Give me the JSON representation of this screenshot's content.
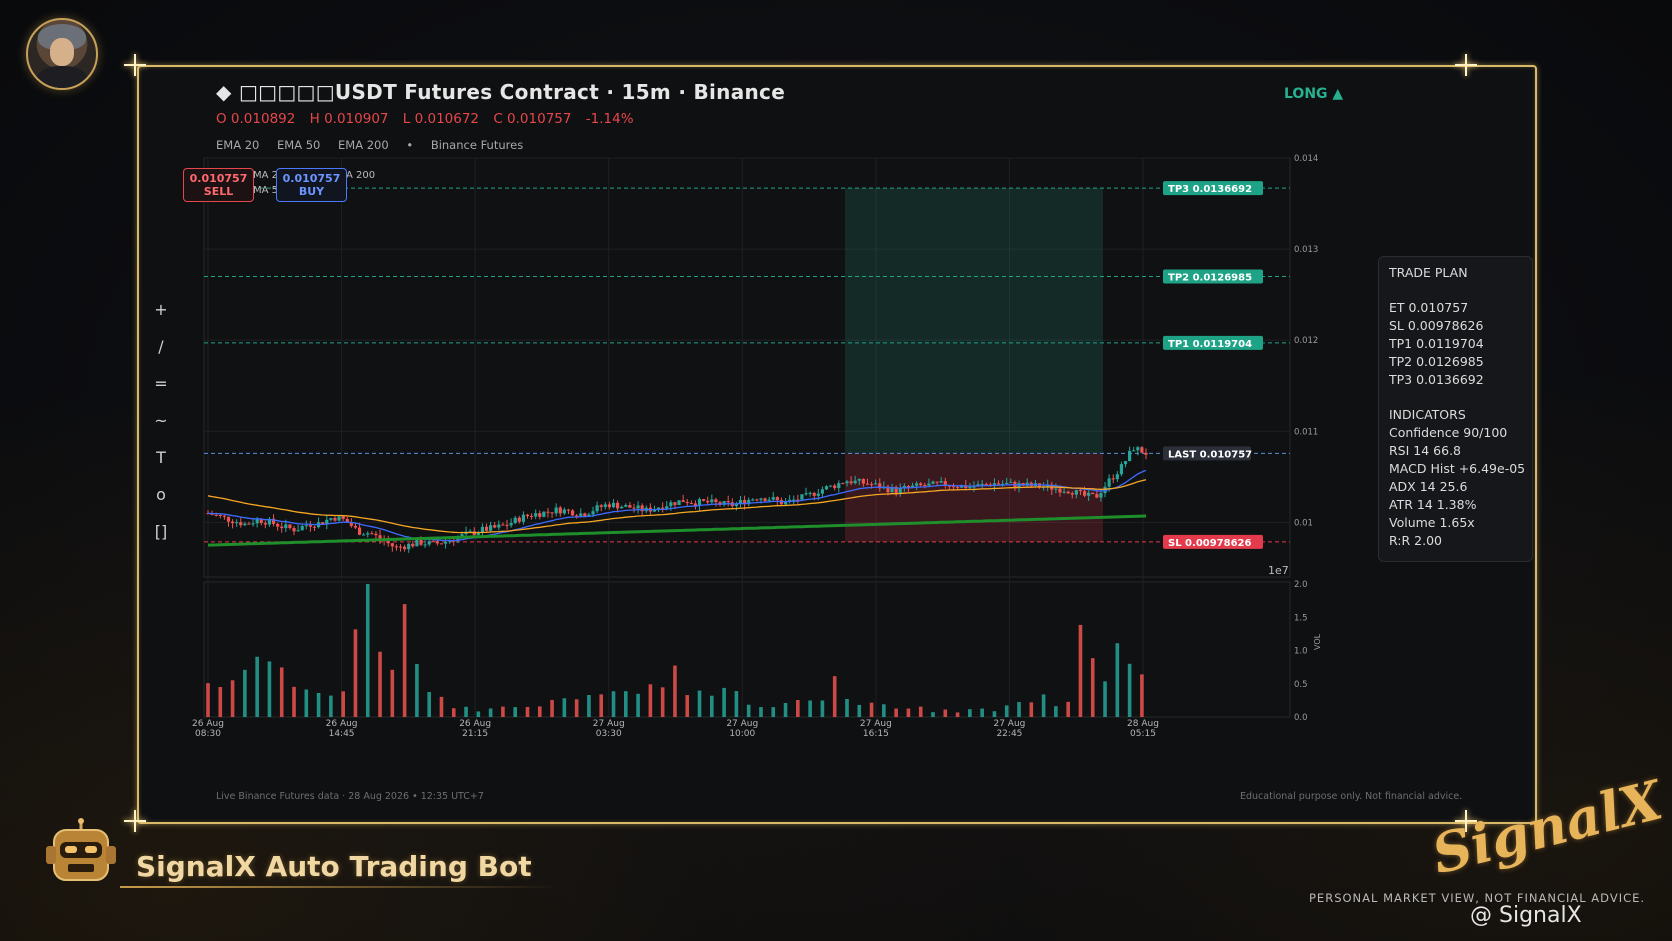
{
  "header": {
    "symbol_icon": "diamond",
    "title": "◆  □□□□□USDT Futures Contract  ·  15m  ·  Binance",
    "ohlc": {
      "o": "O 0.010892",
      "h": "H 0.010907",
      "l": "L 0.010672",
      "c": "C 0.010757",
      "chg": "-1.14%"
    },
    "indicators": [
      "EMA 20",
      "EMA 50",
      "EMA 200",
      "•",
      "Binance Futures"
    ],
    "direction": "LONG ▲"
  },
  "toolbar": [
    "+",
    "/",
    "=",
    "~",
    "T",
    "o",
    "[]"
  ],
  "order_buttons": {
    "sell_price": "0.010757",
    "sell_label": "SELL",
    "buy_price": "0.010757",
    "buy_label": "BUY",
    "ma_fragments": [
      "MA 2",
      "MA 5",
      "A 200"
    ]
  },
  "levels": {
    "tp3": "TP3  0.0136692",
    "tp2": "TP2  0.0126985",
    "tp1": "TP1  0.0119704",
    "last": "LAST  0.010757",
    "sl": "SL  0.00978626"
  },
  "price_axis": [
    "0.014",
    "0.013",
    "0.012",
    "0.011",
    "0.01"
  ],
  "price_multiplier": "1e7",
  "volume_axis": [
    "2.0",
    "1.5",
    "1.0",
    "0.5",
    "0.0"
  ],
  "volume_label": "VOL",
  "time_axis": [
    [
      "26 Aug",
      "08:30"
    ],
    [
      "26 Aug",
      "14:45"
    ],
    [
      "26 Aug",
      "21:15"
    ],
    [
      "27 Aug",
      "03:30"
    ],
    [
      "27 Aug",
      "10:00"
    ],
    [
      "27 Aug",
      "16:15"
    ],
    [
      "27 Aug",
      "22:45"
    ],
    [
      "28 Aug",
      "05:15"
    ]
  ],
  "trade_plan": {
    "title": "TRADE PLAN",
    "et": "ET     0.010757",
    "sl": "SL     0.00978626",
    "tp1": "TP1   0.0119704",
    "tp2": "TP2   0.0126985",
    "tp3": "TP3   0.0136692",
    "ind_title": "INDICATORS",
    "confidence": "Confidence  90/100",
    "rsi": "RSI 14      66.8",
    "macd": "MACD Hist   +6.49e-05",
    "adx": "ADX 14      25.6",
    "atr": "ATR 14      1.38%",
    "volume": "Volume      1.65x",
    "rr": "R:R         2.00"
  },
  "footer": {
    "left": "Live Binance Futures data   ·   28 Aug 2026 • 12:35 UTC+7",
    "right": "Educational purpose only. Not financial advice."
  },
  "branding": {
    "bot_name": "SignalX Auto Trading Bot",
    "logo": "SignalX",
    "tagline": "PERSONAL MARKET VIEW, NOT FINANCIAL ADVICE.",
    "handle": "@ SignalX"
  },
  "colors": {
    "frame": "#d9b869",
    "up": "#26a69a",
    "down": "#ef5350",
    "ema20": "#3d6bff",
    "ema50": "#f5a623",
    "ema200": "#1f8f2b",
    "tp": "#1fa386",
    "sl": "#e33b4b",
    "last": "#5b8fd8"
  },
  "chart_data": {
    "type": "candlestick",
    "price_ylim": [
      0.0094,
      0.014
    ],
    "volume_ylim": [
      0,
      2.0
    ],
    "close_path": [
      0.0101,
      0.01006,
      0.01002,
      0.00998,
      0.01003,
      0.01,
      0.00995,
      0.00992,
      0.00998,
      0.00999,
      0.01006,
      0.01002,
      0.0099,
      0.00988,
      0.0098,
      0.00972,
      0.00975,
      0.00978,
      0.00976,
      0.00979,
      0.00984,
      0.00988,
      0.00992,
      0.00994,
      0.00998,
      0.01005,
      0.01009,
      0.01011,
      0.01014,
      0.01012,
      0.01009,
      0.01015,
      0.0102,
      0.01018,
      0.01016,
      0.01013,
      0.01017,
      0.01021,
      0.01024,
      0.01022,
      0.01022,
      0.0102,
      0.01019,
      0.01024,
      0.01028,
      0.01026,
      0.01021,
      0.01025,
      0.01029,
      0.01036,
      0.0104,
      0.01046,
      0.01044,
      0.01042,
      0.01038,
      0.01035,
      0.01038,
      0.0104,
      0.01041,
      0.01042,
      0.0104,
      0.01039,
      0.01041,
      0.01043,
      0.01042,
      0.01041,
      0.0104,
      0.01039,
      0.01037,
      0.01035,
      0.01029,
      0.01028,
      0.01045,
      0.0106,
      0.01082,
      0.01076
    ],
    "volume_path": [
      0.62,
      0.55,
      0.7,
      0.65,
      0.9,
      0.88,
      0.6,
      0.4,
      0.45,
      0.3,
      0.35,
      0.55,
      1.75,
      1.95,
      0.8,
      0.7,
      1.7,
      0.55,
      0.35,
      0.25,
      0.15,
      0.12,
      0.1,
      0.18,
      0.22,
      0.15,
      0.2,
      0.25,
      0.18,
      0.3,
      0.25,
      0.5,
      0.3,
      0.45,
      0.35,
      0.55,
      0.4,
      0.8,
      0.45,
      0.4,
      0.35,
      0.55,
      0.4,
      0.25,
      0.2,
      0.15,
      0.18,
      0.25,
      0.2,
      0.3,
      0.55,
      0.4,
      0.25,
      0.2,
      0.18,
      0.12,
      0.15,
      0.2,
      0.1,
      0.12,
      0.08,
      0.1,
      0.15,
      0.12,
      0.18,
      0.2,
      0.25,
      0.3,
      0.2,
      0.25,
      1.5,
      0.5,
      0.7,
      1.32,
      0.65,
      0.6
    ]
  }
}
